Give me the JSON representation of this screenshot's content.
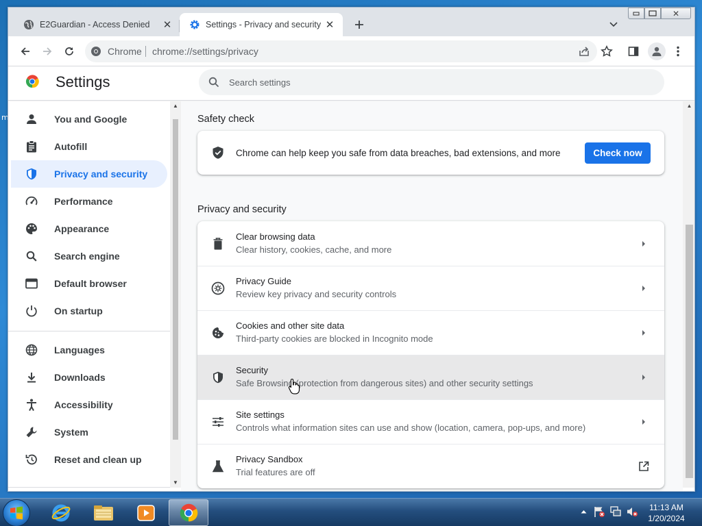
{
  "desktop": {
    "edge_fragment": "m"
  },
  "window": {
    "tabs": [
      {
        "title": "E2Guardian - Access Denied",
        "icon": "globe-icon",
        "close": "✕"
      },
      {
        "title": "Settings - Privacy and security",
        "icon": "settings-gear-icon",
        "close": "✕",
        "active": true
      }
    ],
    "new_tab": "+",
    "controls": {
      "minimize": "▭",
      "maximize": "▢",
      "close": "✕"
    }
  },
  "toolbar": {
    "origin_label": "Chrome",
    "url": "chrome://settings/privacy"
  },
  "settings_header": {
    "title": "Settings",
    "search_placeholder": "Search settings"
  },
  "sidebar": {
    "items": [
      {
        "label": "You and Google",
        "icon": "person-icon"
      },
      {
        "label": "Autofill",
        "icon": "clipboard-icon"
      },
      {
        "label": "Privacy and security",
        "icon": "shield-icon",
        "active": true
      },
      {
        "label": "Performance",
        "icon": "speedometer-icon"
      },
      {
        "label": "Appearance",
        "icon": "palette-icon"
      },
      {
        "label": "Search engine",
        "icon": "search-icon"
      },
      {
        "label": "Default browser",
        "icon": "browser-window-icon"
      },
      {
        "label": "On startup",
        "icon": "power-icon"
      },
      {
        "label": "Languages",
        "icon": "globe-icon"
      },
      {
        "label": "Downloads",
        "icon": "download-icon"
      },
      {
        "label": "Accessibility",
        "icon": "accessibility-icon"
      },
      {
        "label": "System",
        "icon": "wrench-icon"
      },
      {
        "label": "Reset and clean up",
        "icon": "history-icon"
      }
    ]
  },
  "safety_check": {
    "heading": "Safety check",
    "text": "Chrome can help keep you safe from data breaches, bad extensions, and more",
    "button": "Check now"
  },
  "privacy_section": {
    "heading": "Privacy and security",
    "rows": [
      {
        "title": "Clear browsing data",
        "subtitle": "Clear history, cookies, cache, and more",
        "icon": "trash-icon",
        "action": "chevron-right-icon"
      },
      {
        "title": "Privacy Guide",
        "subtitle": "Review key privacy and security controls",
        "icon": "privacy-guide-icon",
        "action": "chevron-right-icon"
      },
      {
        "title": "Cookies and other site data",
        "subtitle": "Third-party cookies are blocked in Incognito mode",
        "icon": "cookie-icon",
        "action": "chevron-right-icon"
      },
      {
        "title": "Security",
        "subtitle": "Safe Browsing (protection from dangerous sites) and other security settings",
        "icon": "shield-icon",
        "action": "chevron-right-icon",
        "hovered": true
      },
      {
        "title": "Site settings",
        "subtitle": "Controls what information sites can use and show (location, camera, pop-ups, and more)",
        "icon": "sliders-icon",
        "action": "chevron-right-icon"
      },
      {
        "title": "Privacy Sandbox",
        "subtitle": "Trial features are off",
        "icon": "flask-icon",
        "action": "external-link-icon"
      }
    ]
  },
  "taskbar": {
    "apps": [
      "internet-explorer-icon",
      "file-explorer-icon",
      "media-player-icon",
      "chrome-icon"
    ],
    "clock": {
      "time": "11:13 AM",
      "date": "1/20/2024"
    }
  },
  "colors": {
    "accent": "#1a73e8",
    "active_nav_bg": "#e8f0fe",
    "hover_row_bg": "#e8e8e9"
  }
}
